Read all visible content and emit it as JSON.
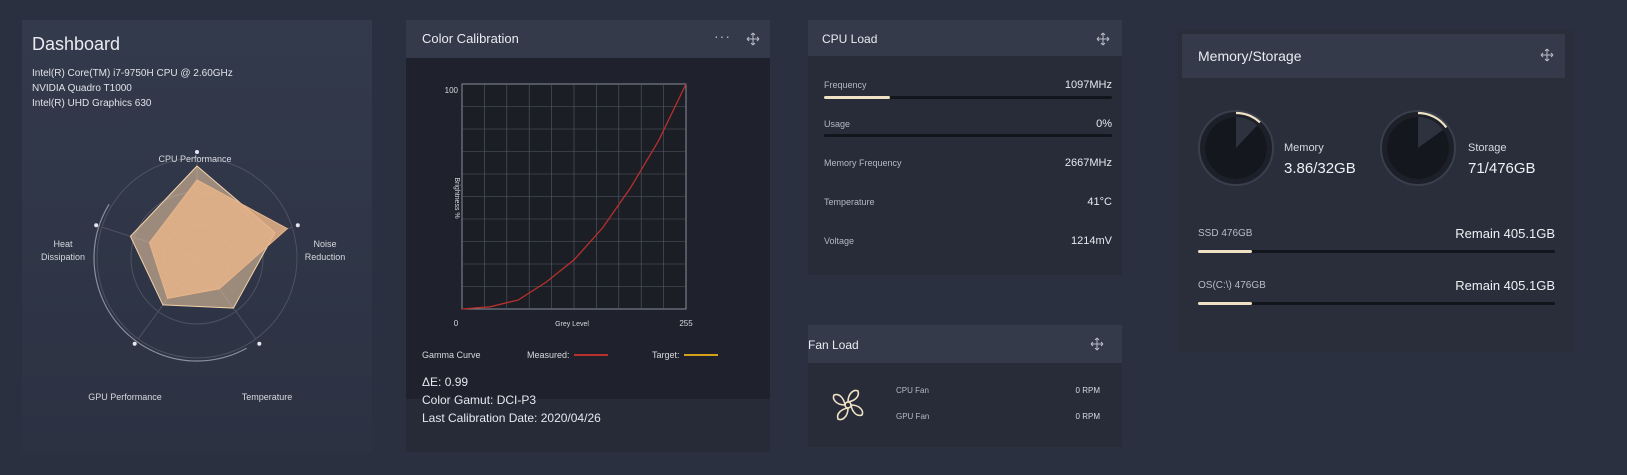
{
  "dashboard": {
    "title": "Dashboard",
    "specs": [
      "Intel(R) Core(TM) i7-9750H CPU @ 2.60GHz",
      "NVIDIA Quadro T1000",
      "Intel(R) UHD Graphics 630"
    ],
    "radar": {
      "axes": [
        "CPU Performance",
        "Noise Reduction",
        "Temperature",
        "GPU Performance",
        "Heat Dissipation"
      ],
      "series": [
        {
          "values": [
            0.92,
            0.82,
            0.62,
            0.58,
            0.7
          ],
          "color": "#f5d2a8"
        },
        {
          "values": [
            0.78,
            0.95,
            0.38,
            0.5,
            0.5
          ],
          "color": "#e8b489"
        }
      ]
    },
    "labels": {
      "cpu": "CPU Performance",
      "noise_l1": "Noise",
      "noise_l2": "Reduction",
      "temp": "Temperature",
      "gpu": "GPU Performance",
      "heat_l1": "Heat",
      "heat_l2": "Dissipation"
    }
  },
  "calibration": {
    "title": "Color Calibration",
    "chart_data": {
      "type": "line",
      "xlabel": "Grey Level",
      "ylabel": "Brightness %",
      "xlim": [
        0,
        255
      ],
      "ylim": [
        0,
        100
      ],
      "x_ticks": [
        "0",
        "255"
      ],
      "y_ticks": [
        "100"
      ],
      "grid": true,
      "series": [
        {
          "name": "Measured:",
          "color": "#b8302a",
          "x": [
            0,
            32,
            64,
            96,
            128,
            160,
            192,
            224,
            255
          ],
          "values": [
            0,
            1,
            4,
            12,
            22,
            36,
            54,
            75,
            100
          ]
        },
        {
          "name": "Target:",
          "color": "#d4a017",
          "x": [],
          "values": []
        }
      ]
    },
    "legend": {
      "curve": "Gamma Curve",
      "measured": "Measured:",
      "target": "Target:"
    },
    "delta_e": "ΔE: 0.99",
    "gamut": "Color Gamut: DCI-P3",
    "date": "Last Calibration Date: 2020/04/26"
  },
  "cpu_load": {
    "title": "CPU Load",
    "rows": [
      {
        "label": "Frequency",
        "value": "1097MHz",
        "fill": 0.23
      },
      {
        "label": "Usage",
        "value": "0%",
        "fill": 0.0
      }
    ],
    "plain_rows": [
      {
        "label": "Memory Frequency",
        "value": "2667MHz"
      },
      {
        "label": "Temperature",
        "value": "41°C"
      },
      {
        "label": "Voltage",
        "value": "1214mV"
      }
    ]
  },
  "fan_load": {
    "title": "Fan Load",
    "fans": [
      {
        "label": "CPU Fan",
        "value": "0 RPM"
      },
      {
        "label": "GPU Fan",
        "value": "0 RPM"
      }
    ]
  },
  "memory": {
    "title": "Memory/Storage",
    "memory_label": "Memory",
    "memory_value": "3.86/32GB",
    "memory_fill": 0.12,
    "storage_label": "Storage",
    "storage_value": "71/476GB",
    "storage_fill": 0.15,
    "drives": [
      {
        "label": "SSD 476GB",
        "value": "Remain 405.1GB",
        "fill": 0.15
      },
      {
        "label": "OS(C:\\) 476GB",
        "value": "Remain 405.1GB",
        "fill": 0.15
      }
    ]
  },
  "colors": {
    "accent": "#efe2c4",
    "measured": "#b8302a",
    "target": "#d4a017"
  }
}
